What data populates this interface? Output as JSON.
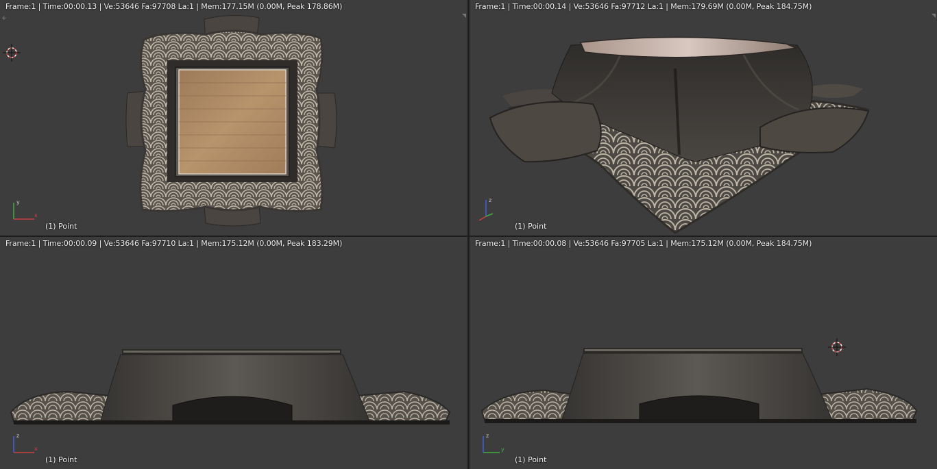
{
  "viewports": [
    {
      "id": "top-left",
      "stats": "Frame:1 | Time:00:00.13 | Ve:53646 Fa:97708 La:1 | Mem:177.15M (0.00M, Peak 178.86M)",
      "object_label": "(1) Point",
      "axis_labels": [
        "y",
        "x"
      ],
      "view": "top"
    },
    {
      "id": "top-right",
      "stats": "Frame:1 | Time:00:00.14 | Ve:53646 Fa:97712 La:1 | Mem:179.69M (0.00M, Peak 184.75M)",
      "object_label": "(1) Point",
      "axis_labels": [
        "z"
      ],
      "view": "perspective"
    },
    {
      "id": "bottom-left",
      "stats": "Frame:1 | Time:00:00.09 | Ve:53646 Fa:97710 La:1 | Mem:175.12M (0.00M, Peak 183.29M)",
      "object_label": "(1) Point",
      "axis_labels": [
        "z",
        "x"
      ],
      "view": "front"
    },
    {
      "id": "bottom-right",
      "stats": "Frame:1 | Time:00:00.08 | Ve:53646 Fa:97705 La:1 | Mem:175.12M (0.00M, Peak 184.75M)",
      "object_label": "(1) Point",
      "axis_labels": [
        "z",
        "y"
      ],
      "view": "side"
    }
  ],
  "colors": {
    "viewport_bg": "#3d3d3d",
    "cloth_dark": "#3a3734",
    "cloth_mid": "#5a544d",
    "pattern_light": "#bdb6a8",
    "wood": "#b08a66",
    "axis_x": "#d04040",
    "axis_y": "#40b040",
    "axis_z": "#4060e0"
  },
  "icons": [
    "3d-cursor-icon",
    "axis-gizmo-icon"
  ]
}
